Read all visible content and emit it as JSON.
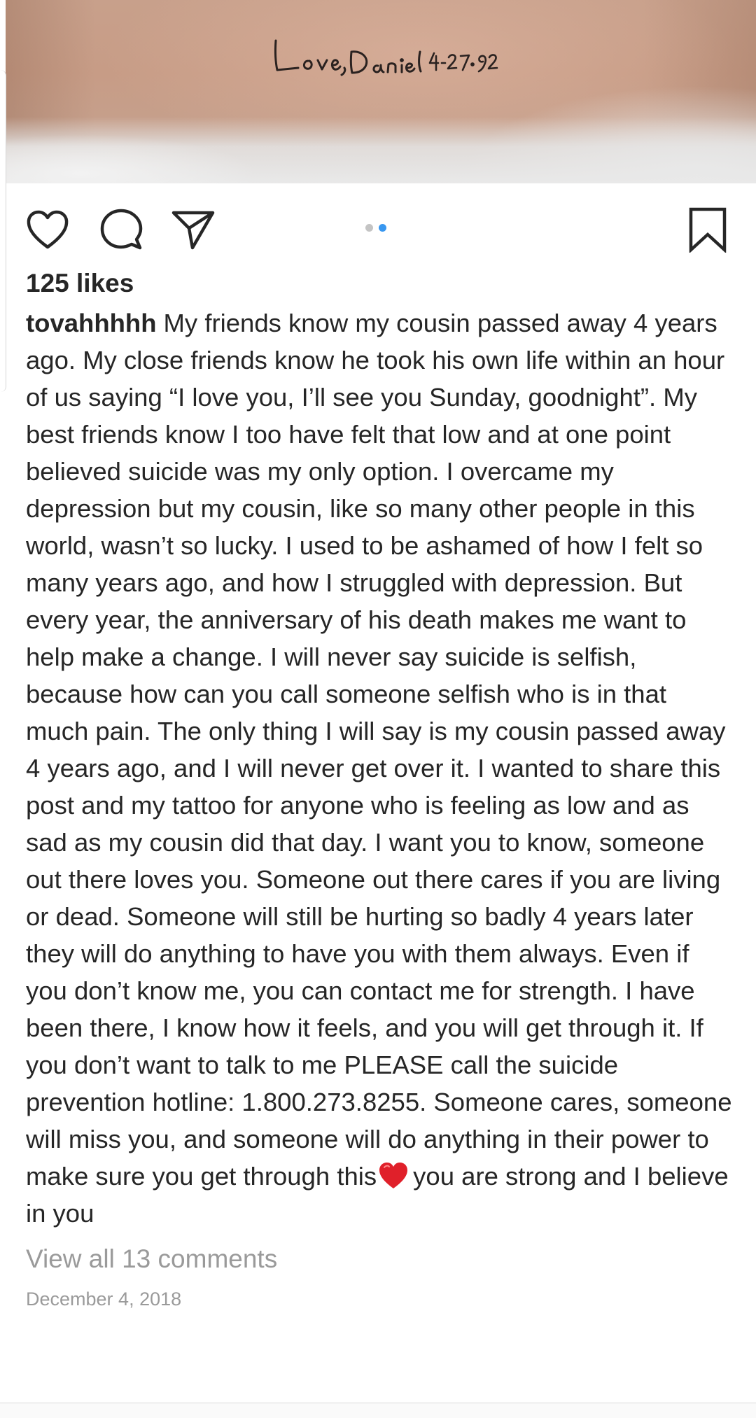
{
  "photo": {
    "tattoo_text": "Love, Daniel 4-27-92"
  },
  "actions": {
    "like_icon": "heart-outline-icon",
    "comment_icon": "speech-bubble-icon",
    "share_icon": "paper-plane-icon",
    "save_icon": "bookmark-icon",
    "carousel_count": 2,
    "carousel_active_index": 1
  },
  "post": {
    "likes": "125 likes",
    "username": "tovahhhhh",
    "caption_before_emoji": "My friends know my cousin passed away 4 years ago. My close friends know he took his own life within an hour of us saying “I love you, I’ll see you Sunday, goodnight”. My best friends know I too have felt that low and at one point believed suicide was my only option. I overcame my depression but my cousin, like so many other people in this world, wasn’t so lucky. I used to be ashamed of how I felt so many years ago, and how I struggled with depression. But every year, the anniversary of his death makes me want to help make a change. I will never say suicide is selfish, because how can you call someone selfish who is in that much pain. The only thing I will say is my cousin passed away 4 years ago, and I will never get over it. I wanted to share this post and my tattoo for anyone who is feeling as low and as sad as my cousin did that day. I want you to know, someone out there loves you. Someone out there cares if you are living or dead. Someone will still be hurting so badly 4 years later they will do anything to have you with them always. Even if you don’t know me, you can contact me for strength. I have been there, I know how it feels, and you will get through it. If you don’t want to talk to me PLEASE call the suicide prevention hotline: 1.800.273.8255. Someone cares, someone will miss you, and someone will do anything in their power to make sure you get through this",
    "emoji": "red-heart-emoji",
    "caption_after_emoji": "you are strong and I believe in you",
    "view_comments": "View all 13 comments",
    "date": "December 4, 2018"
  },
  "colors": {
    "text": "#262626",
    "muted": "#9a9a9a",
    "carousel_active": "#3897f0",
    "carousel_inactive": "#c4c4c4",
    "heart_emoji": "#e0202a"
  }
}
